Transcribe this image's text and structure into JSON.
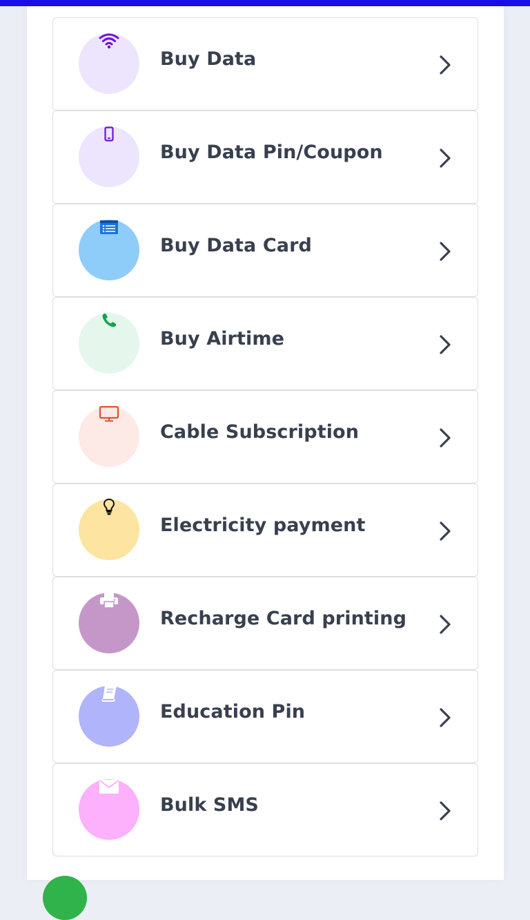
{
  "menu": {
    "items": [
      {
        "label": "Buy Data",
        "icon": "wifi-icon",
        "circle_color": "#ede5fd",
        "icon_color": "#6f12d9"
      },
      {
        "label": "Buy Data Pin/Coupon",
        "icon": "mobile-phone-icon",
        "circle_color": "#ede5fd",
        "icon_color": "#6f12d9"
      },
      {
        "label": "Buy Data Card",
        "icon": "card-list-icon",
        "circle_color": "#8ecdf9",
        "icon_color": "#1a73d9"
      },
      {
        "label": "Buy Airtime",
        "icon": "phone-icon",
        "circle_color": "#e5f6ec",
        "icon_color": "#15a34a"
      },
      {
        "label": "Cable Subscription",
        "icon": "tv-monitor-icon",
        "circle_color": "#fde9e6",
        "icon_color": "#e0502f"
      },
      {
        "label": "Electricity payment",
        "icon": "lightbulb-icon",
        "circle_color": "#fde4a0",
        "icon_color": "#111111"
      },
      {
        "label": "Recharge Card printing",
        "icon": "printer-icon",
        "circle_color": "#c597c8",
        "icon_color": "#ffffff"
      },
      {
        "label": "Education Pin",
        "icon": "book-icon",
        "circle_color": "#b0b4fb",
        "icon_color": "#ffffff"
      },
      {
        "label": "Bulk SMS",
        "icon": "envelope-icon",
        "circle_color": "#fdb0fb",
        "icon_color": "#ffffff"
      }
    ]
  },
  "colors": {
    "top_bar": "#1a0fe6",
    "label_text": "#38404f",
    "chevron": "#38404f",
    "fab": "#2fb34a"
  }
}
